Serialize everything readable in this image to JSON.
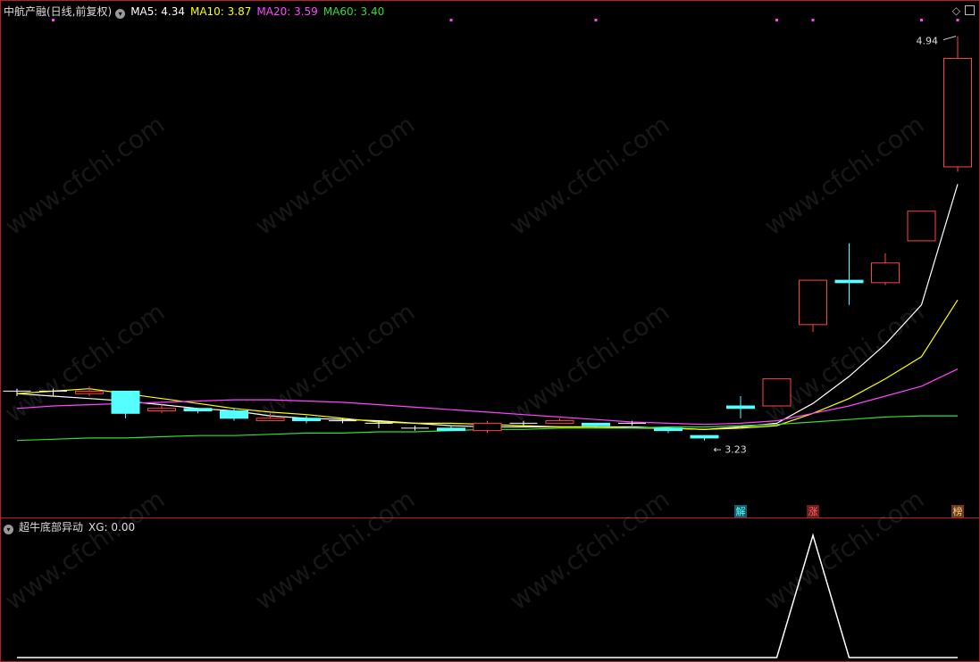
{
  "main_header": {
    "stock": "中航产融(日线,前复权)",
    "indicators": [
      {
        "label": "MA5: 4.34",
        "color": "#ffffff"
      },
      {
        "label": "MA10: 3.87",
        "color": "#ffff00"
      },
      {
        "label": "MA20: 3.59",
        "color": "#ff44ff"
      },
      {
        "label": "MA60: 3.40",
        "color": "#33dd33"
      }
    ]
  },
  "sub_header": {
    "name": "超牛底部异动",
    "xg": "XG: 0.00"
  },
  "watermark": "www.cfchi.com",
  "chart_data": {
    "type": "candlestick",
    "ylim": [
      3.06,
      5.0
    ],
    "up_color": "#ff4444",
    "down_color": "#55ffff",
    "labels": {
      "high": "4.94",
      "low": "3.23",
      "markers": [
        {
          "index": 20,
          "text": "解",
          "bg": "#1b5b6b",
          "color": "#55ffff"
        },
        {
          "index": 22,
          "text": "涨",
          "bg": "#6b1b1b",
          "color": "#ff6666"
        },
        {
          "index": 26,
          "text": "榜",
          "bg": "#6b3b1b",
          "color": "#ffcc88"
        }
      ]
    },
    "candles": [
      {
        "o": 3.5,
        "h": 3.51,
        "l": 3.48,
        "c": 3.5
      },
      {
        "o": 3.5,
        "h": 3.51,
        "l": 3.48,
        "c": 3.5
      },
      {
        "o": 3.49,
        "h": 3.52,
        "l": 3.48,
        "c": 3.5
      },
      {
        "o": 3.5,
        "h": 3.5,
        "l": 3.39,
        "c": 3.41
      },
      {
        "o": 3.42,
        "h": 3.45,
        "l": 3.41,
        "c": 3.43
      },
      {
        "o": 3.43,
        "h": 3.43,
        "l": 3.41,
        "c": 3.42
      },
      {
        "o": 3.42,
        "h": 3.43,
        "l": 3.38,
        "c": 3.39
      },
      {
        "o": 3.38,
        "h": 3.41,
        "l": 3.38,
        "c": 3.39
      },
      {
        "o": 3.39,
        "h": 3.4,
        "l": 3.37,
        "c": 3.38
      },
      {
        "o": 3.38,
        "h": 3.39,
        "l": 3.37,
        "c": 3.38
      },
      {
        "o": 3.37,
        "h": 3.38,
        "l": 3.35,
        "c": 3.37
      },
      {
        "o": 3.35,
        "h": 3.36,
        "l": 3.34,
        "c": 3.35
      },
      {
        "o": 3.35,
        "h": 3.36,
        "l": 3.34,
        "c": 3.34
      },
      {
        "o": 3.34,
        "h": 3.38,
        "l": 3.33,
        "c": 3.37
      },
      {
        "o": 3.37,
        "h": 3.38,
        "l": 3.36,
        "c": 3.37
      },
      {
        "o": 3.37,
        "h": 3.39,
        "l": 3.37,
        "c": 3.38
      },
      {
        "o": 3.37,
        "h": 3.37,
        "l": 3.35,
        "c": 3.36
      },
      {
        "o": 3.37,
        "h": 3.38,
        "l": 3.36,
        "c": 3.37
      },
      {
        "o": 3.35,
        "h": 3.35,
        "l": 3.33,
        "c": 3.34
      },
      {
        "o": 3.32,
        "h": 3.32,
        "l": 3.3,
        "c": 3.31
      },
      {
        "o": 3.44,
        "h": 3.48,
        "l": 3.39,
        "c": 3.43
      },
      {
        "o": 3.44,
        "h": 3.55,
        "l": 3.44,
        "c": 3.55
      },
      {
        "o": 3.77,
        "h": 3.95,
        "l": 3.74,
        "c": 3.95
      },
      {
        "o": 3.95,
        "h": 4.1,
        "l": 3.85,
        "c": 3.94
      },
      {
        "o": 3.94,
        "h": 4.06,
        "l": 3.93,
        "c": 4.02
      },
      {
        "o": 4.11,
        "h": 4.23,
        "l": 4.11,
        "c": 4.23
      },
      {
        "o": 4.41,
        "h": 4.94,
        "l": 4.39,
        "c": 4.85
      }
    ],
    "series": [
      {
        "name": "MA5",
        "color": "#ffffff",
        "values": [
          3.49,
          3.48,
          3.47,
          3.46,
          3.445,
          3.43,
          3.42,
          3.4,
          3.39,
          3.385,
          3.38,
          3.37,
          3.36,
          3.355,
          3.355,
          3.355,
          3.355,
          3.355,
          3.35,
          3.345,
          3.355,
          3.37,
          3.45,
          3.56,
          3.69,
          3.85,
          4.34
        ]
      },
      {
        "name": "MA10",
        "color": "#ffff00",
        "values": [
          3.49,
          3.5,
          3.51,
          3.49,
          3.47,
          3.45,
          3.43,
          3.415,
          3.405,
          3.39,
          3.375,
          3.37,
          3.37,
          3.365,
          3.36,
          3.355,
          3.355,
          3.35,
          3.35,
          3.345,
          3.35,
          3.36,
          3.41,
          3.47,
          3.55,
          3.64,
          3.87
        ]
      },
      {
        "name": "MA20",
        "color": "#ff44ff",
        "values": [
          3.43,
          3.44,
          3.445,
          3.45,
          3.455,
          3.46,
          3.465,
          3.465,
          3.46,
          3.455,
          3.445,
          3.435,
          3.425,
          3.415,
          3.405,
          3.395,
          3.385,
          3.375,
          3.37,
          3.365,
          3.37,
          3.38,
          3.41,
          3.44,
          3.48,
          3.52,
          3.59
        ]
      },
      {
        "name": "MA60",
        "color": "#33dd33",
        "values": [
          3.3,
          3.305,
          3.31,
          3.31,
          3.315,
          3.32,
          3.32,
          3.325,
          3.33,
          3.33,
          3.335,
          3.335,
          3.34,
          3.345,
          3.345,
          3.35,
          3.35,
          3.35,
          3.355,
          3.355,
          3.36,
          3.365,
          3.375,
          3.385,
          3.395,
          3.4,
          3.4
        ]
      }
    ],
    "xg": {
      "color": "#ffffff",
      "values": [
        0,
        0,
        0,
        0,
        0,
        0,
        0,
        0,
        0,
        0,
        0,
        0,
        0,
        0,
        0,
        0,
        0,
        0,
        0,
        0,
        0,
        0,
        1,
        0,
        0,
        0,
        0
      ]
    },
    "top_marks": [
      1,
      12,
      16,
      21,
      22,
      25,
      26
    ]
  }
}
